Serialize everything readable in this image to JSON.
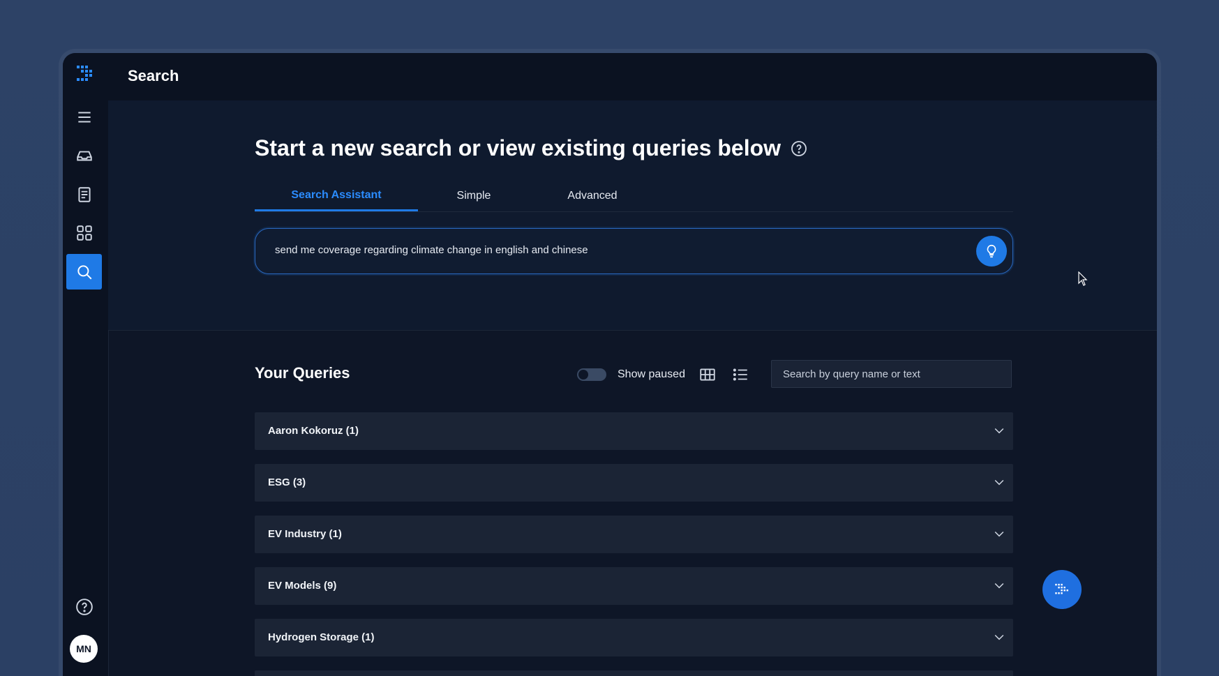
{
  "app": {
    "title": "Search"
  },
  "sidebar": {
    "items": [
      {
        "icon": "menu-icon"
      },
      {
        "icon": "inbox-icon"
      },
      {
        "icon": "document-icon"
      },
      {
        "icon": "apps-grid-icon"
      },
      {
        "icon": "search-icon",
        "active": true
      }
    ],
    "help_icon": "help-icon",
    "avatar_initials": "MN"
  },
  "hero": {
    "heading": "Start a new search or view existing queries below",
    "tabs": [
      {
        "label": "Search Assistant",
        "active": true
      },
      {
        "label": "Simple"
      },
      {
        "label": "Advanced"
      }
    ],
    "search_text": "send me coverage regarding climate change in english and chinese"
  },
  "queries": {
    "title": "Your Queries",
    "show_paused_label": "Show paused",
    "search_placeholder": "Search by query name or text",
    "groups": [
      {
        "label": "Aaron Kokoruz (1)"
      },
      {
        "label": "ESG (3)"
      },
      {
        "label": "EV Industry (1)"
      },
      {
        "label": "EV Models (9)"
      },
      {
        "label": "Hydrogen Storage (1)"
      }
    ]
  },
  "colors": {
    "accent": "#1f7ae6",
    "background": "#0e1627"
  }
}
